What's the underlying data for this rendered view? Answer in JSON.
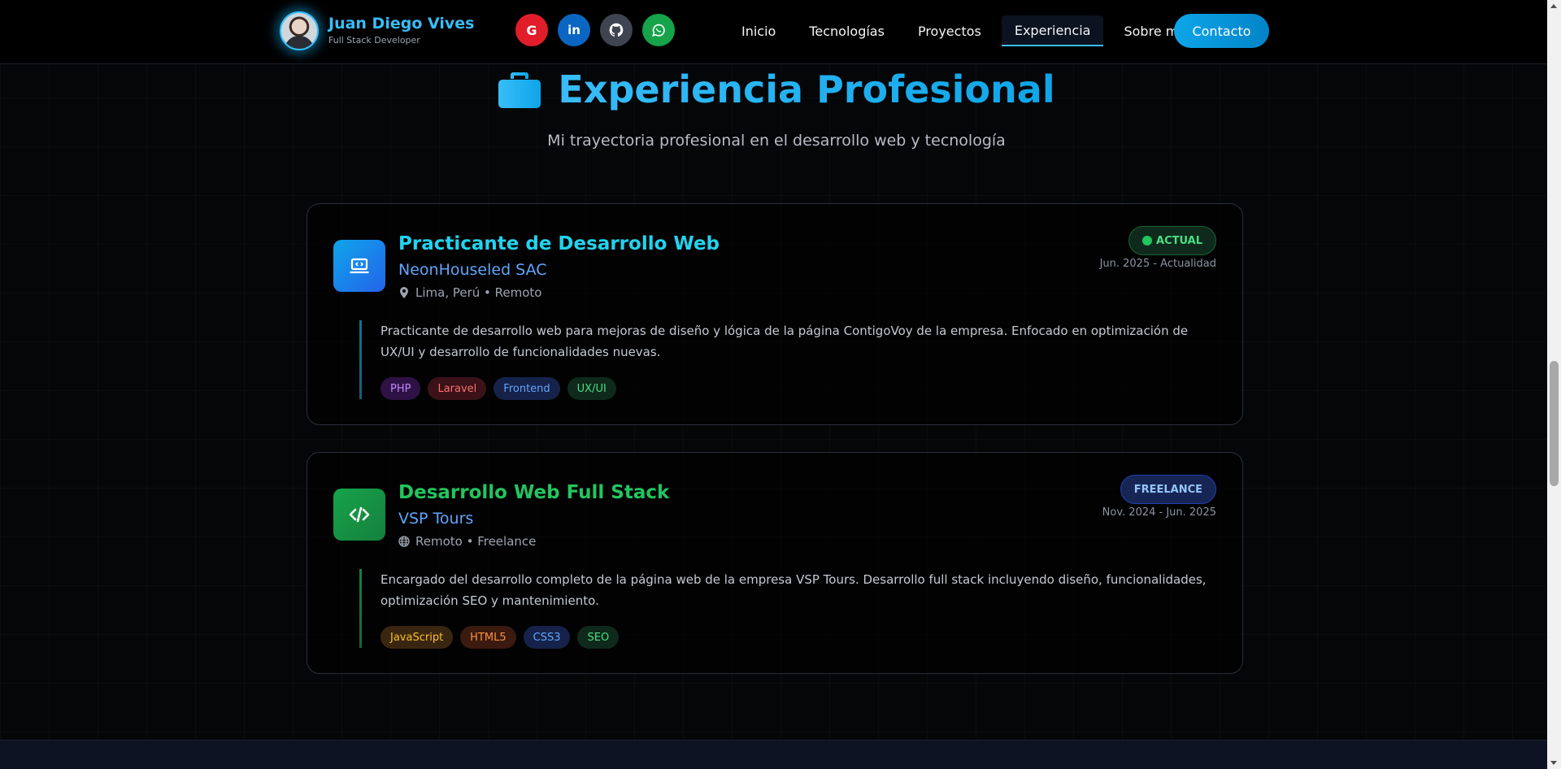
{
  "header": {
    "name": "Juan Diego Vives",
    "role": "Full Stack Developer",
    "socials": [
      {
        "icon": "google-icon",
        "label": "G",
        "color": "#e11d2a"
      },
      {
        "icon": "linkedin-icon",
        "label": "in",
        "color": "#0a66c2"
      },
      {
        "icon": "github-icon",
        "label": "",
        "color": "#3f4451"
      },
      {
        "icon": "whatsapp-icon",
        "label": "",
        "color": "#16a34a"
      }
    ],
    "nav": [
      "Inicio",
      "Tecnologías",
      "Proyectos",
      "Experiencia",
      "Sobre mí"
    ],
    "active_nav": "Experiencia",
    "contact_label": "Contacto"
  },
  "section": {
    "title": "Experiencia Profesional",
    "subtitle": "Mi trayectoria profesional en el desarrollo web y tecnología",
    "title_icon": "briefcase-icon"
  },
  "experiences": [
    {
      "title": "Practicante de Desarrollo Web",
      "company": "NeonHouseled SAC",
      "location": "Lima, Perú • Remoto",
      "location_icon": "map-pin-icon",
      "badge": "ACTUAL",
      "date": "Jun. 2025 - Actualidad",
      "icon": "laptop-code-icon",
      "accent": "#22d3ee",
      "description": "Practicante de desarrollo web para mejoras de diseño y lógica de la página ContigoVoy de la empresa. Enfocado en optimización de UX/UI y desarrollo de funcionalidades nuevas.",
      "tags": [
        "PHP",
        "Laravel",
        "Frontend",
        "UX/UI"
      ]
    },
    {
      "title": "Desarrollo Web Full Stack",
      "company": "VSP Tours",
      "location": "Remoto • Freelance",
      "location_icon": "globe-icon",
      "badge": "FREELANCE",
      "date": "Nov. 2024 - Jun. 2025",
      "icon": "code-icon",
      "accent": "#22c55e",
      "description": "Encargado del desarrollo completo de la página web de la empresa VSP Tours. Desarrollo full stack incluyendo diseño, funcionalidades, optimización SEO y mantenimiento.",
      "tags": [
        "JavaScript",
        "HTML5",
        "CSS3",
        "SEO"
      ]
    }
  ]
}
